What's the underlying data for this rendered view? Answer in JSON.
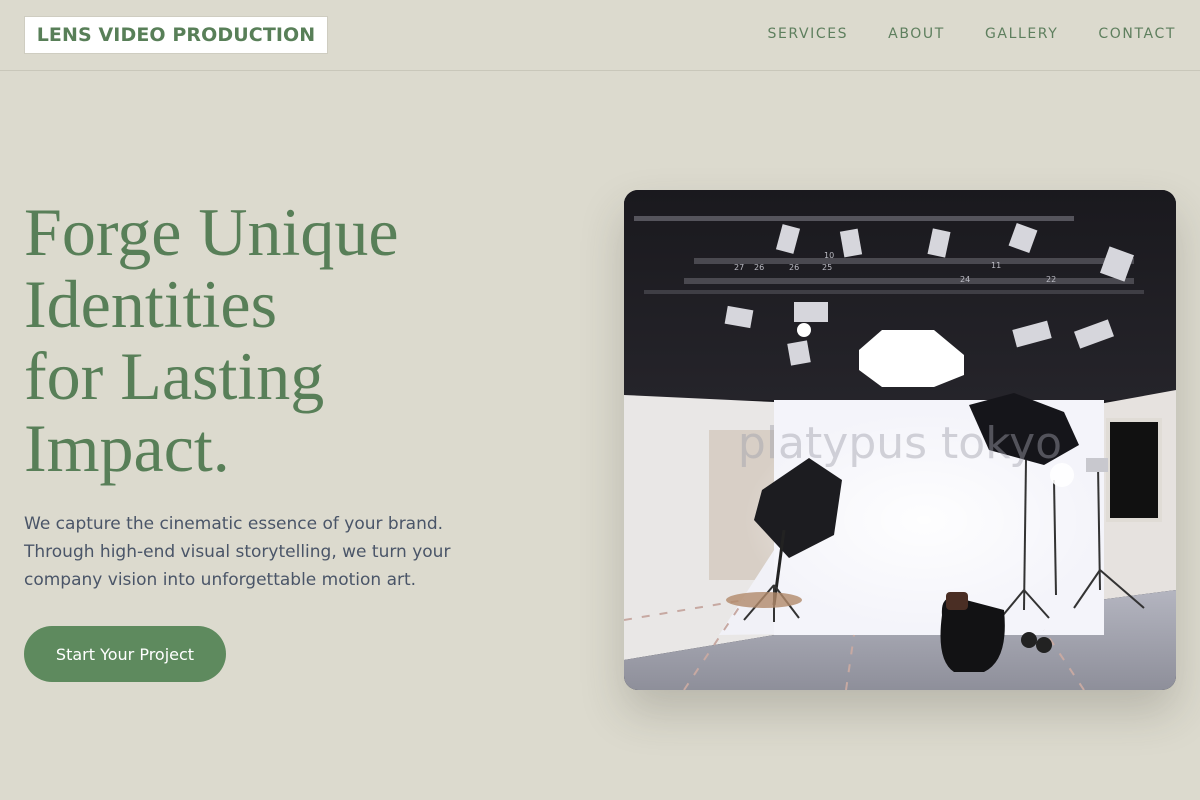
{
  "header": {
    "logo": "LENS VIDEO PRODUCTION",
    "nav": [
      "SERVICES",
      "ABOUT",
      "GALLERY",
      "CONTACT"
    ]
  },
  "hero": {
    "title_lines": [
      "Forge Unique",
      "Identities",
      "for Lasting",
      "Impact."
    ],
    "description": "We capture the cinematic essence of your brand. Through high-end visual storytelling, we turn your company vision into unforgettable motion art.",
    "cta": "Start Your Project",
    "image_watermark": "platypus tokyo"
  },
  "colors": {
    "background": "#dcdace",
    "accent": "#587f58",
    "button": "#5e8a5e",
    "text": "#4a5568"
  }
}
